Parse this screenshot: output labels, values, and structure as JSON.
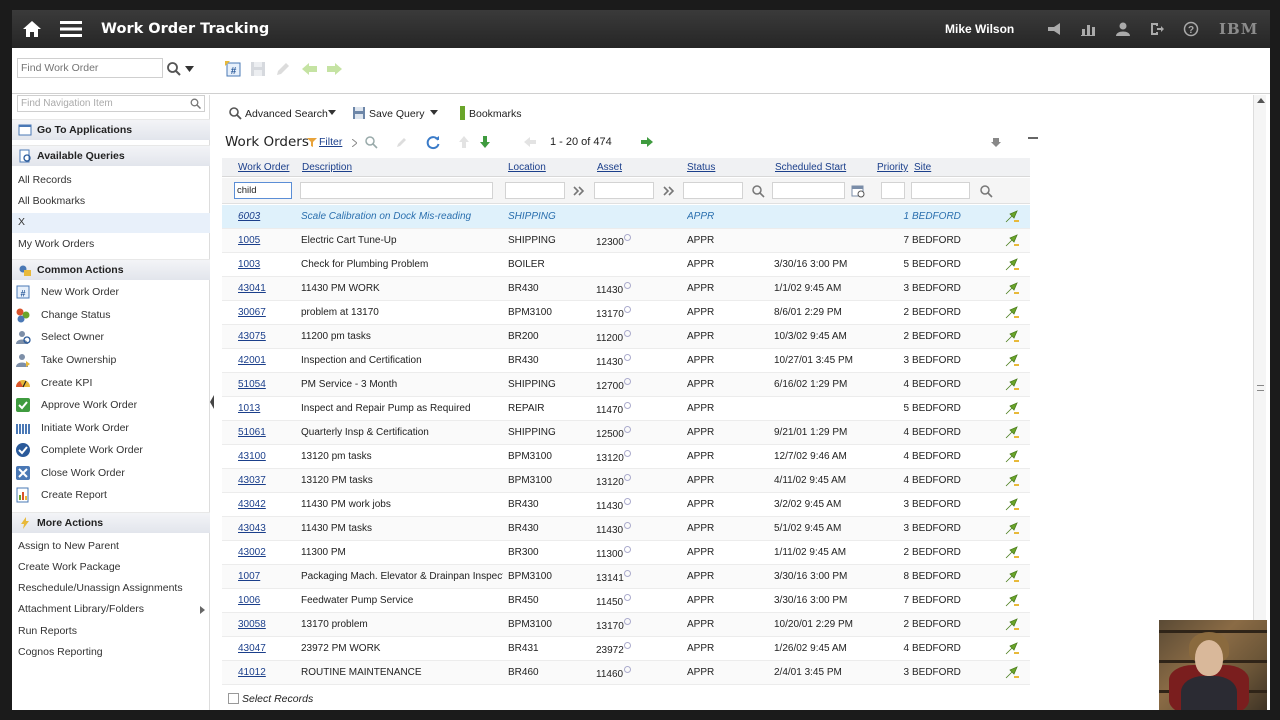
{
  "app": {
    "title": "Work Order Tracking",
    "user": "Mike Wilson",
    "brand": "IBM"
  },
  "toolbar": {
    "find_placeholder": "Find Work Order"
  },
  "sidebar": {
    "find_placeholder": "Find Navigation Item",
    "go_to_applications": "Go To Applications",
    "available_queries": "Available Queries",
    "queries": [
      "All Records",
      "All Bookmarks",
      "X",
      "My Work Orders"
    ],
    "common_actions": "Common Actions",
    "actions": [
      {
        "label": "New Work Order",
        "icon": "new-work-order-icon"
      },
      {
        "label": "Change Status",
        "icon": "change-status-icon"
      },
      {
        "label": "Select Owner",
        "icon": "select-owner-icon"
      },
      {
        "label": "Take Ownership",
        "icon": "take-ownership-icon"
      },
      {
        "label": "Create KPI",
        "icon": "kpi-gauge-icon"
      },
      {
        "label": "Approve Work Order",
        "icon": "approve-check-icon"
      },
      {
        "label": "Initiate Work Order",
        "icon": "initiate-icon"
      },
      {
        "label": "Complete Work Order",
        "icon": "complete-check-icon"
      },
      {
        "label": "Close Work Order",
        "icon": "close-x-icon"
      },
      {
        "label": "Create Report",
        "icon": "report-icon"
      }
    ],
    "more_actions": "More Actions",
    "more": [
      "Assign to New Parent",
      "Create Work Package",
      "Reschedule/Unassign Assignments",
      "Attachment Library/Folders",
      "Run Reports",
      "Cognos Reporting"
    ]
  },
  "querybar": {
    "advanced_search": "Advanced Search",
    "save_query": "Save Query",
    "bookmarks": "Bookmarks"
  },
  "list": {
    "title": "Work Orders",
    "filter": "Filter",
    "paging": "1 -   20 of 474",
    "columns": [
      "Work Order",
      "Description",
      "Location",
      "Asset",
      "Status",
      "Scheduled Start",
      "Priority",
      "Site"
    ],
    "filter_value": "child",
    "rows": [
      [
        "6003",
        "Scale Calibration on Dock Mis-reading",
        "SHIPPING",
        "",
        "APPR",
        "",
        "1",
        "BEDFORD"
      ],
      [
        "1005",
        "Electric Cart Tune-Up",
        "SHIPPING",
        "12300",
        "APPR",
        "",
        "7",
        "BEDFORD"
      ],
      [
        "1003",
        "Check for Plumbing Problem",
        "BOILER",
        "",
        "APPR",
        "3/30/16 3:00 PM",
        "5",
        "BEDFORD"
      ],
      [
        "43041",
        "11430 PM WORK",
        "BR430",
        "11430",
        "APPR",
        "1/1/02 9:45 AM",
        "3",
        "BEDFORD"
      ],
      [
        "30067",
        "problem at 13170",
        "BPM3100",
        "13170",
        "APPR",
        "8/6/01 2:29 PM",
        "2",
        "BEDFORD"
      ],
      [
        "43075",
        "11200 pm tasks",
        "BR200",
        "11200",
        "APPR",
        "10/3/02 9:45 AM",
        "2",
        "BEDFORD"
      ],
      [
        "42001",
        "Inspection and Certification",
        "BR430",
        "11430",
        "APPR",
        "10/27/01 3:45 PM",
        "3",
        "BEDFORD"
      ],
      [
        "51054",
        "PM Service - 3 Month",
        "SHIPPING",
        "12700",
        "APPR",
        "6/16/02 1:29 PM",
        "4",
        "BEDFORD"
      ],
      [
        "1013",
        "Inspect and Repair Pump as Required",
        "REPAIR",
        "11470",
        "APPR",
        "",
        "5",
        "BEDFORD"
      ],
      [
        "51061",
        "Quarterly Insp & Certification",
        "SHIPPING",
        "12500",
        "APPR",
        "9/21/01 1:29 PM",
        "4",
        "BEDFORD"
      ],
      [
        "43100",
        "13120 pm tasks",
        "BPM3100",
        "13120",
        "APPR",
        "12/7/02 9:46 AM",
        "4",
        "BEDFORD"
      ],
      [
        "43037",
        "13120 PM tasks",
        "BPM3100",
        "13120",
        "APPR",
        "4/11/02 9:45 AM",
        "4",
        "BEDFORD"
      ],
      [
        "43042",
        "11430 PM work jobs",
        "BR430",
        "11430",
        "APPR",
        "3/2/02 9:45 AM",
        "3",
        "BEDFORD"
      ],
      [
        "43043",
        "11430 PM tasks",
        "BR430",
        "11430",
        "APPR",
        "5/1/02 9:45 AM",
        "3",
        "BEDFORD"
      ],
      [
        "43002",
        "11300 PM",
        "BR300",
        "11300",
        "APPR",
        "1/11/02 9:45 AM",
        "2",
        "BEDFORD"
      ],
      [
        "1007",
        "Packaging Mach. Elevator & Drainpan Inspection",
        "BPM3100",
        "13141",
        "APPR",
        "3/30/16 3:00 PM",
        "8",
        "BEDFORD"
      ],
      [
        "1006",
        "Feedwater Pump Service",
        "BR450",
        "11450",
        "APPR",
        "3/30/16 3:00 PM",
        "7",
        "BEDFORD"
      ],
      [
        "30058",
        "13170 problem",
        "BPM3100",
        "13170",
        "APPR",
        "10/20/01 2:29 PM",
        "2",
        "BEDFORD"
      ],
      [
        "43047",
        "23972 PM WORK",
        "BR431",
        "23972",
        "APPR",
        "1/26/02 9:45 AM",
        "4",
        "BEDFORD"
      ],
      [
        "41012",
        "ROUTINE MAINTENANCE",
        "BR460",
        "11460",
        "APPR",
        "2/4/01 3:45 PM",
        "3",
        "BEDFORD"
      ]
    ],
    "select_records": "Select Records"
  },
  "colors": {
    "header_bg": "#2e2e2e",
    "link": "#1b3f8b",
    "highlight_row": "#dff1fb",
    "action_green": "#6aa52a"
  }
}
